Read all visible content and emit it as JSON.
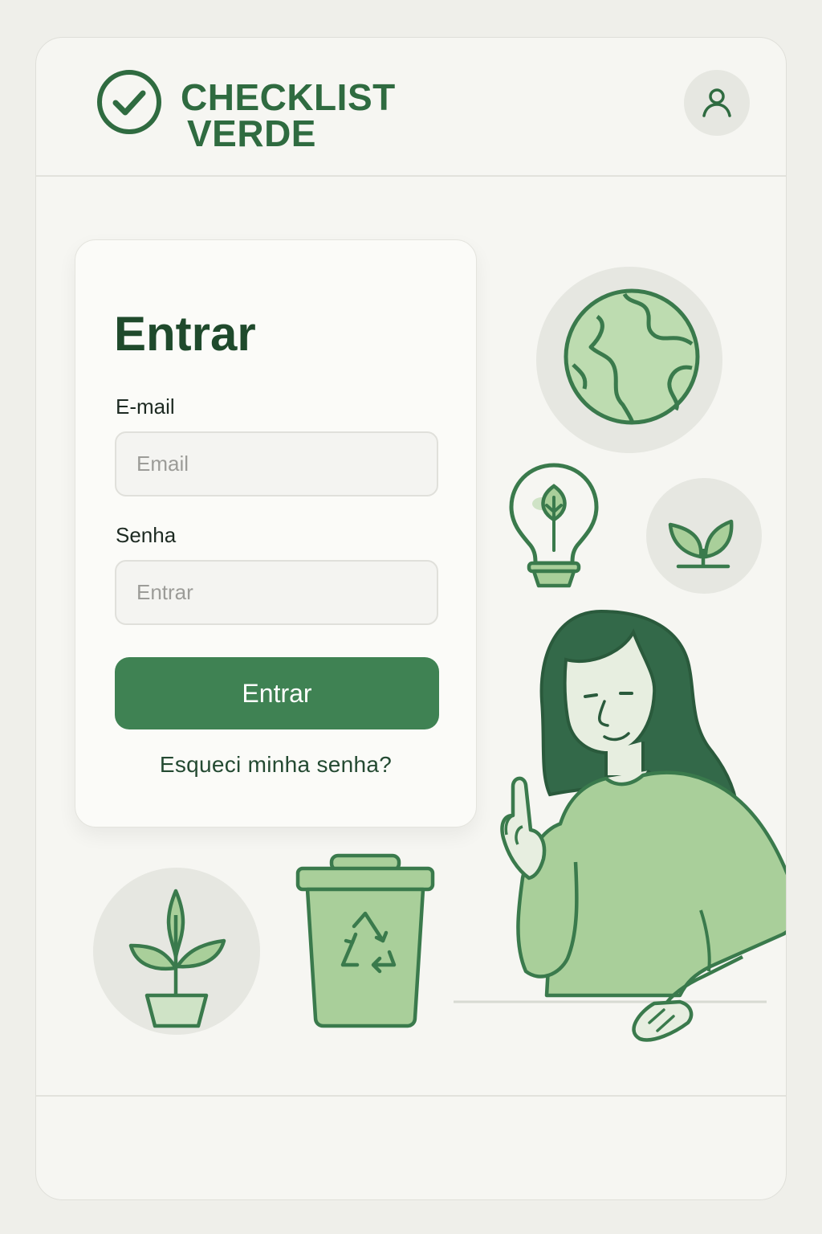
{
  "header": {
    "brand_line1": "CHECKLIST",
    "brand_line2": "VERDE",
    "logo_icon": "check-circle-icon",
    "profile_icon": "user-icon"
  },
  "login": {
    "title": "Entrar",
    "email_label": "E-mail",
    "email_placeholder": "Email",
    "password_label": "Senha",
    "password_placeholder": "Entrar",
    "submit_label": "Entrar",
    "forgot_link": "Esqueci minha senha?"
  },
  "illustrations": [
    "globe-icon",
    "eco-lightbulb-icon",
    "sprout-icon",
    "potted-plant-icon",
    "recycling-bin-icon",
    "woman-pointing-illustration"
  ],
  "colors": {
    "brand_green": "#2f6b40",
    "button_green": "#3f8253",
    "light_green": "#a9cf9a",
    "background": "#f6f6f2"
  }
}
